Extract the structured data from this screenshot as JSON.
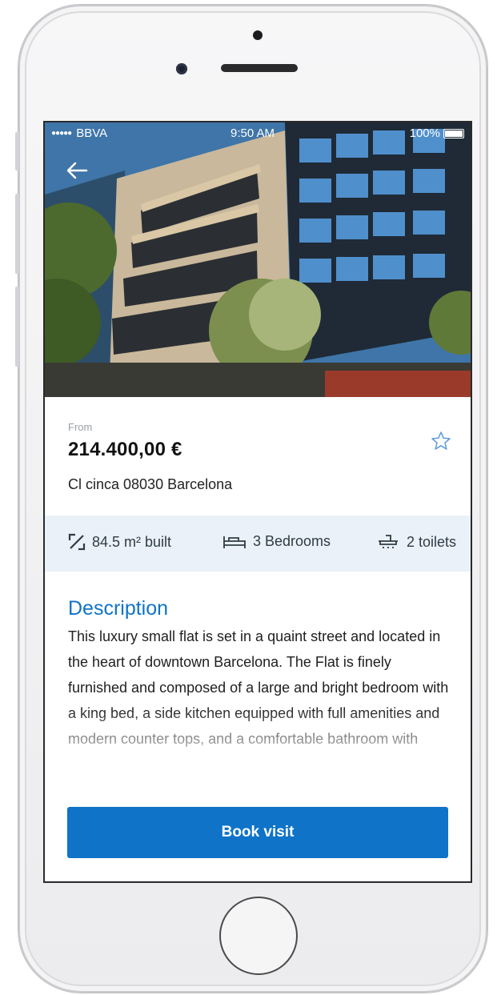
{
  "status_bar": {
    "carrier": "BBVA",
    "time": "9:50 AM",
    "battery": "100%"
  },
  "listing": {
    "from_label": "From",
    "price": "214.400,00 €",
    "address": "Cl cinca 08030 Barcelona"
  },
  "features": {
    "area": "84.5 m² built",
    "bedrooms": "3 Bedrooms",
    "toilets": "2 toilets"
  },
  "description": {
    "title": "Description",
    "text": "This luxury small flat is set in a quaint street and located in the heart of downtown Barcelona. The Flat is finely furnished and composed of a large and bright bedroom with a king bed, a side kitchen equipped with full amenities and modern counter tops, and a comfortable bathroom with"
  },
  "actions": {
    "book_visit": "Book visit"
  },
  "icons": {
    "back": "back-arrow-icon",
    "favorite": "star-icon",
    "area": "expand-icon",
    "bedrooms": "bed-icon",
    "toilets": "toilet-icon"
  },
  "colors": {
    "accent": "#0f73c8",
    "features_bg": "#eaf1f8"
  }
}
